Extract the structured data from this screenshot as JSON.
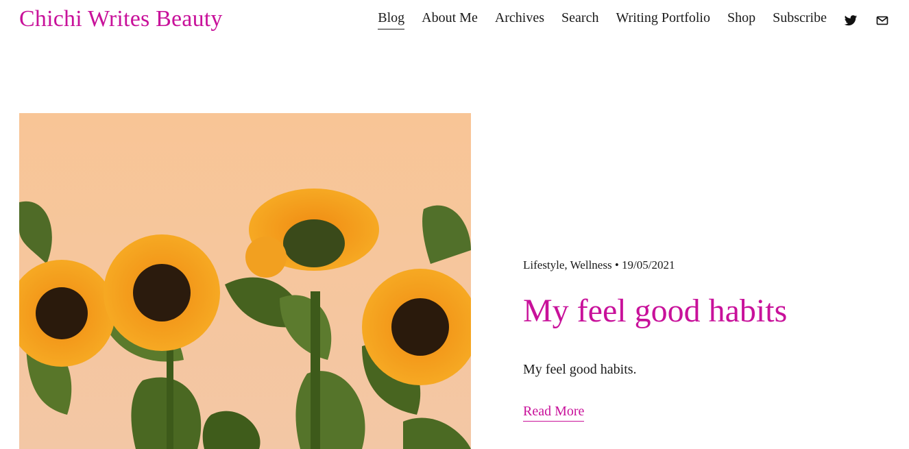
{
  "site": {
    "title": "Chichi Writes Beauty",
    "brand_color": "#c8119a"
  },
  "nav": {
    "items": [
      {
        "label": "Blog",
        "active": true
      },
      {
        "label": "About Me"
      },
      {
        "label": "Archives"
      },
      {
        "label": "Search"
      },
      {
        "label": "Writing Portfolio"
      },
      {
        "label": "Shop"
      },
      {
        "label": "Subscribe"
      }
    ],
    "social": [
      {
        "icon": "twitter-icon"
      },
      {
        "icon": "mail-icon"
      }
    ]
  },
  "post": {
    "categories": "Lifestyle, Wellness",
    "separator": "•",
    "date": "19/05/2021",
    "title": "My feel good habits",
    "excerpt": "My feel good habits.",
    "read_more": "Read More",
    "image_subject": "sunflowers"
  }
}
